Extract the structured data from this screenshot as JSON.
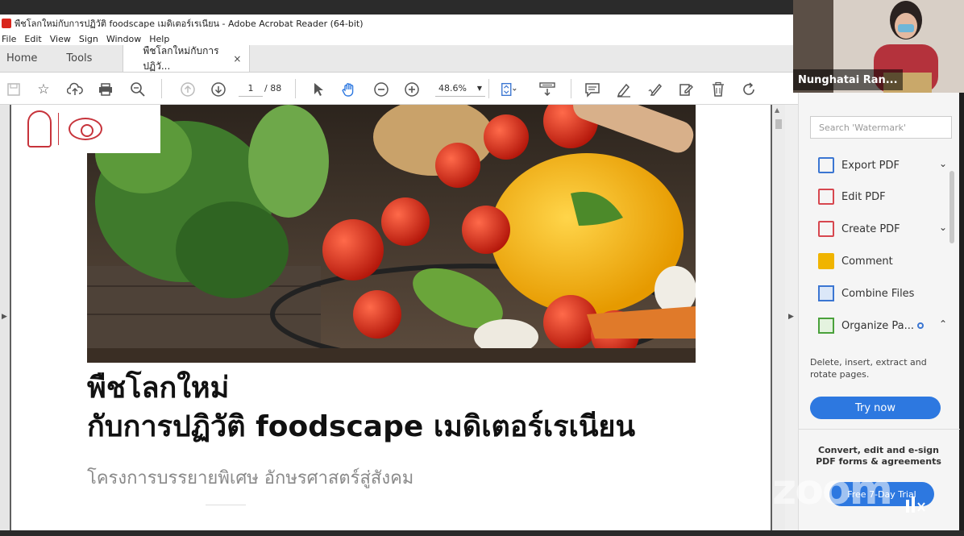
{
  "window": {
    "title": "พืชโลกใหม่กับการปฏิวัติ foodscape เมดิเตอร์เรเนียน - Adobe Acrobat Reader (64-bit)"
  },
  "menu": [
    "File",
    "Edit",
    "View",
    "Sign",
    "Window",
    "Help"
  ],
  "tabs": {
    "home": "Home",
    "tools": "Tools",
    "doc": "พืชโลกใหม่กับการปฏิวั...",
    "close": "×"
  },
  "toolbar": {
    "page_current": "1",
    "page_total": "/ 88",
    "zoom": "48.6%"
  },
  "document": {
    "title_line1": "พืชโลกใหม่",
    "title_line2": "กับการปฏิวัติ foodscape เมดิเตอร์เรเนียน",
    "subtitle": "โครงการบรรยายพิเศษ อักษรศาสตร์สู่สังคม"
  },
  "panel": {
    "search_placeholder": "Search 'Watermark'",
    "items": [
      {
        "label": "Export PDF"
      },
      {
        "label": "Edit PDF"
      },
      {
        "label": "Create PDF"
      },
      {
        "label": "Comment"
      },
      {
        "label": "Combine Files"
      },
      {
        "label": "Organize Pa..."
      }
    ],
    "organize_desc": "Delete, insert, extract and rotate pages.",
    "try_now": "Try now",
    "promo": "Convert, edit and e-sign PDF forms & agreements",
    "free_trial": "Free 7-Day Trial"
  },
  "video": {
    "participant_name": "Nunghatai Ran..."
  },
  "overlay": {
    "zoom_watermark": "zoom"
  },
  "colors": {
    "accent_blue": "#2d78e0",
    "acrobat_red": "#d9261c"
  }
}
